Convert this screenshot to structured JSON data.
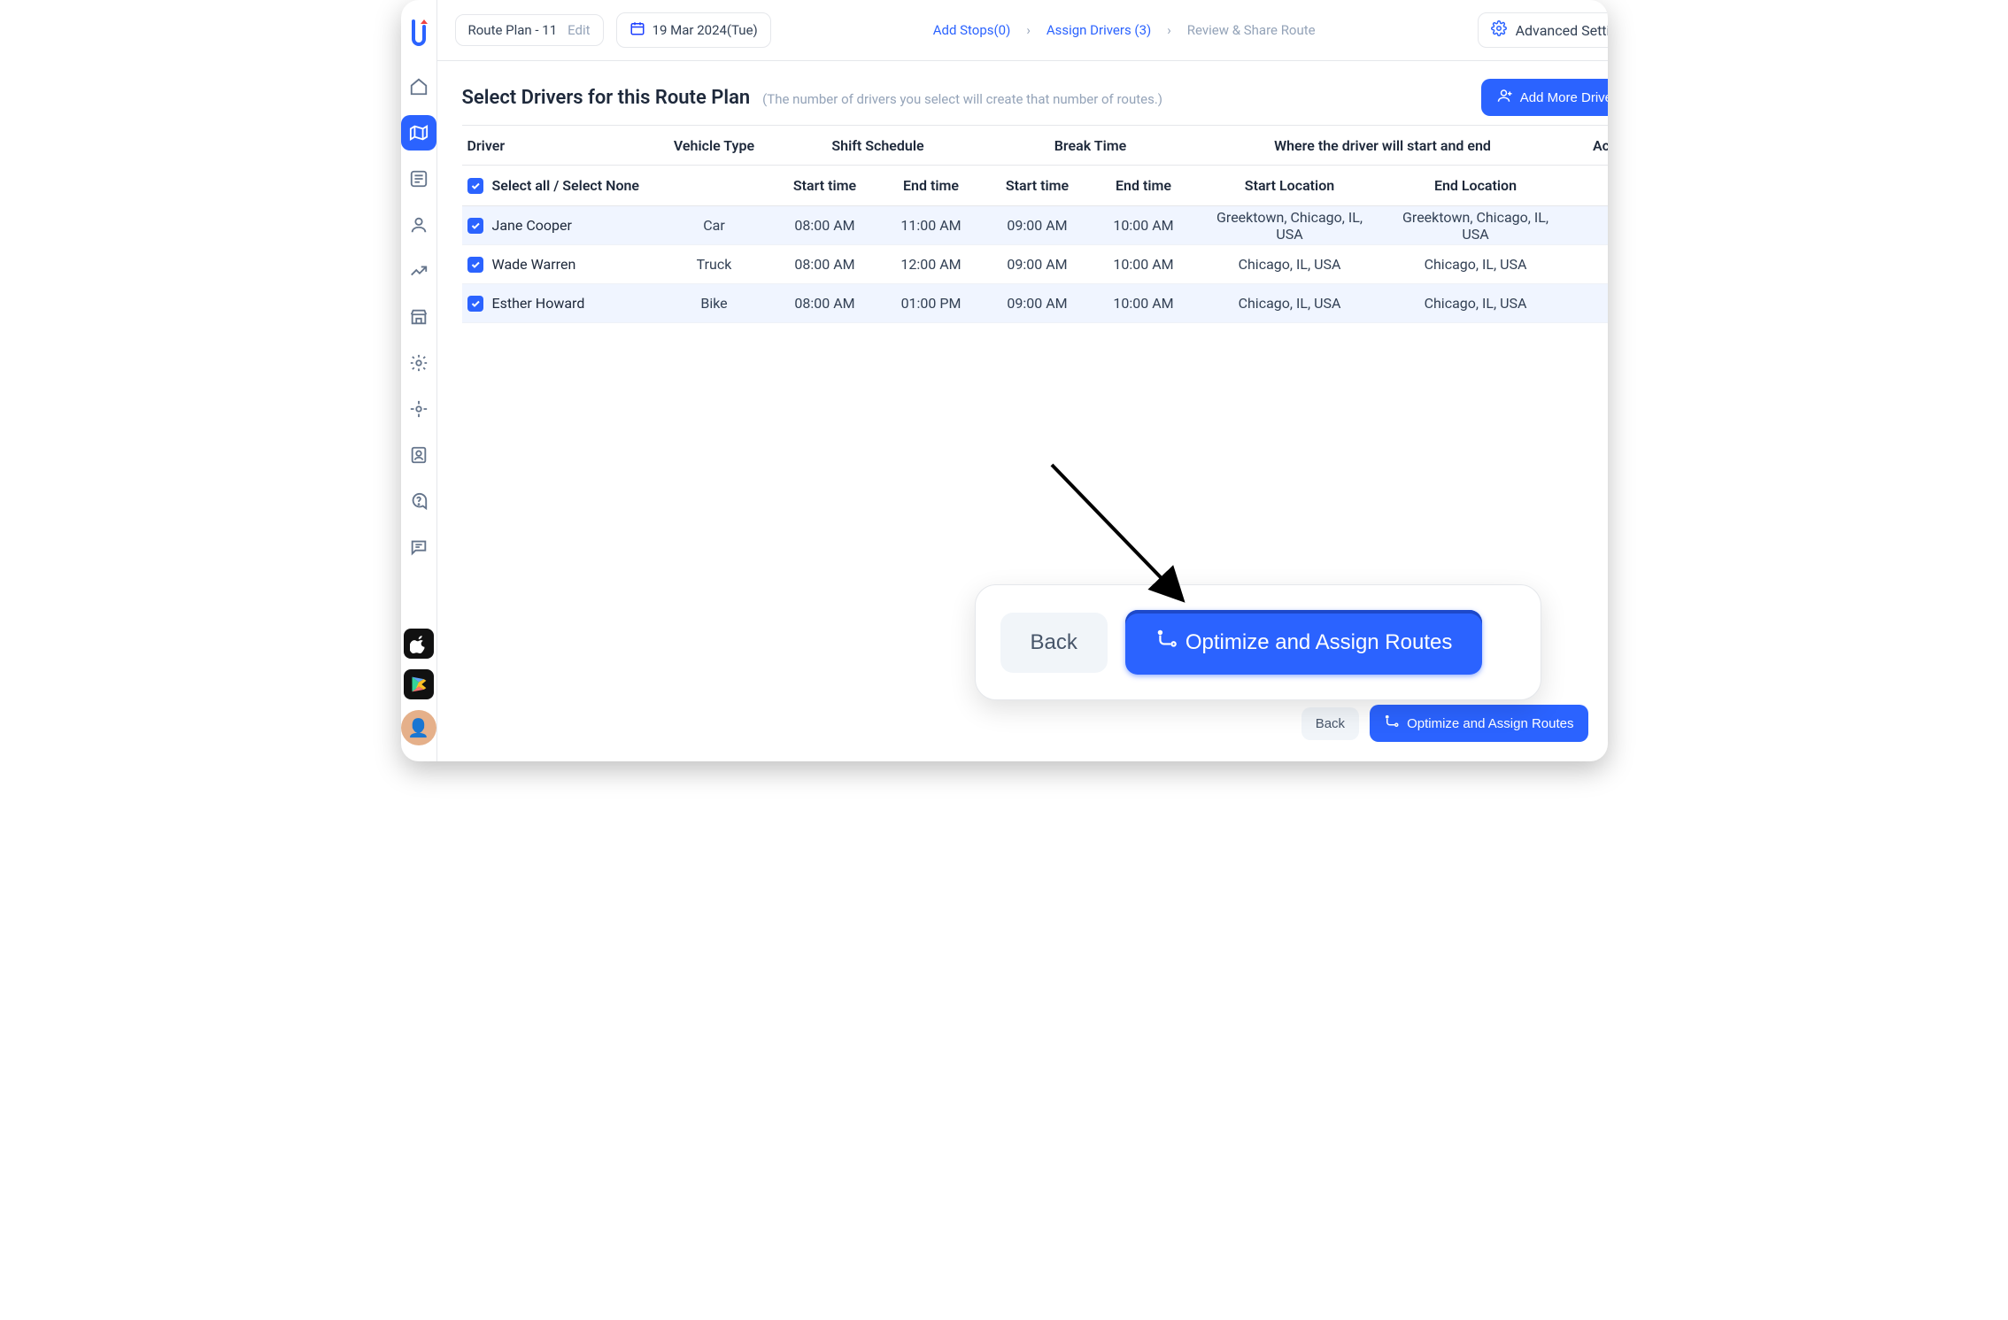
{
  "topbar": {
    "plan_title": "Route Plan - 11",
    "edit_label": "Edit",
    "date_text": "19 Mar 2024(Tue)",
    "advanced_label": "Advanced Settings"
  },
  "breadcrumbs": {
    "add_stops": "Add Stops(0)",
    "assign_drivers": "Assign Drivers (3)",
    "review": "Review & Share Route"
  },
  "page": {
    "title": "Select Drivers for this Route Plan",
    "subtitle": "(The number of drivers you select will create that number of routes.)",
    "add_drivers_btn": "Add More Drivers"
  },
  "table": {
    "headers": {
      "driver": "Driver",
      "vehicle": "Vehicle Type",
      "shift": "Shift Schedule",
      "break": "Break Time",
      "where": "Where the driver will start and end",
      "action": "Action"
    },
    "subheaders": {
      "select_all": "Select all / Select None",
      "shift_start": "Start time",
      "shift_end": "End time",
      "break_start": "Start time",
      "break_end": "End time",
      "start_loc": "Start Location",
      "end_loc": "End Location"
    },
    "rows": [
      {
        "name": "Jane Cooper",
        "vehicle": "Car",
        "shift_start": "08:00 AM",
        "shift_end": "11:00 AM",
        "break_start": "09:00 AM",
        "break_end": "10:00 AM",
        "start_loc": "Greektown, Chicago, IL, USA",
        "end_loc": "Greektown, Chicago, IL, USA"
      },
      {
        "name": "Wade Warren",
        "vehicle": "Truck",
        "shift_start": "08:00 AM",
        "shift_end": "12:00 AM",
        "break_start": "09:00 AM",
        "break_end": "10:00 AM",
        "start_loc": "Chicago, IL, USA",
        "end_loc": "Chicago, IL, USA"
      },
      {
        "name": "Esther Howard",
        "vehicle": "Bike",
        "shift_start": "08:00 AM",
        "shift_end": "01:00 PM",
        "break_start": "09:00 AM",
        "break_end": "10:00 AM",
        "start_loc": "Chicago, IL, USA",
        "end_loc": "Chicago, IL, USA"
      }
    ]
  },
  "callout": {
    "back": "Back",
    "optimize": "Optimize and Assign Routes"
  },
  "footer": {
    "back": "Back",
    "optimize": "Optimize and Assign Routes"
  }
}
